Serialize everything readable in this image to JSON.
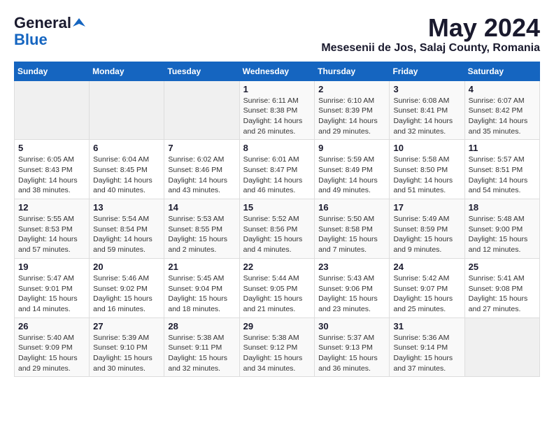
{
  "header": {
    "logo_general": "General",
    "logo_blue": "Blue",
    "month": "May 2024",
    "location": "Mesesenii de Jos, Salaj County, Romania"
  },
  "days_of_week": [
    "Sunday",
    "Monday",
    "Tuesday",
    "Wednesday",
    "Thursday",
    "Friday",
    "Saturday"
  ],
  "weeks": [
    [
      {
        "day": "",
        "info": ""
      },
      {
        "day": "",
        "info": ""
      },
      {
        "day": "",
        "info": ""
      },
      {
        "day": "1",
        "info": "Sunrise: 6:11 AM\nSunset: 8:38 PM\nDaylight: 14 hours and 26 minutes."
      },
      {
        "day": "2",
        "info": "Sunrise: 6:10 AM\nSunset: 8:39 PM\nDaylight: 14 hours and 29 minutes."
      },
      {
        "day": "3",
        "info": "Sunrise: 6:08 AM\nSunset: 8:41 PM\nDaylight: 14 hours and 32 minutes."
      },
      {
        "day": "4",
        "info": "Sunrise: 6:07 AM\nSunset: 8:42 PM\nDaylight: 14 hours and 35 minutes."
      }
    ],
    [
      {
        "day": "5",
        "info": "Sunrise: 6:05 AM\nSunset: 8:43 PM\nDaylight: 14 hours and 38 minutes."
      },
      {
        "day": "6",
        "info": "Sunrise: 6:04 AM\nSunset: 8:45 PM\nDaylight: 14 hours and 40 minutes."
      },
      {
        "day": "7",
        "info": "Sunrise: 6:02 AM\nSunset: 8:46 PM\nDaylight: 14 hours and 43 minutes."
      },
      {
        "day": "8",
        "info": "Sunrise: 6:01 AM\nSunset: 8:47 PM\nDaylight: 14 hours and 46 minutes."
      },
      {
        "day": "9",
        "info": "Sunrise: 5:59 AM\nSunset: 8:49 PM\nDaylight: 14 hours and 49 minutes."
      },
      {
        "day": "10",
        "info": "Sunrise: 5:58 AM\nSunset: 8:50 PM\nDaylight: 14 hours and 51 minutes."
      },
      {
        "day": "11",
        "info": "Sunrise: 5:57 AM\nSunset: 8:51 PM\nDaylight: 14 hours and 54 minutes."
      }
    ],
    [
      {
        "day": "12",
        "info": "Sunrise: 5:55 AM\nSunset: 8:53 PM\nDaylight: 14 hours and 57 minutes."
      },
      {
        "day": "13",
        "info": "Sunrise: 5:54 AM\nSunset: 8:54 PM\nDaylight: 14 hours and 59 minutes."
      },
      {
        "day": "14",
        "info": "Sunrise: 5:53 AM\nSunset: 8:55 PM\nDaylight: 15 hours and 2 minutes."
      },
      {
        "day": "15",
        "info": "Sunrise: 5:52 AM\nSunset: 8:56 PM\nDaylight: 15 hours and 4 minutes."
      },
      {
        "day": "16",
        "info": "Sunrise: 5:50 AM\nSunset: 8:58 PM\nDaylight: 15 hours and 7 minutes."
      },
      {
        "day": "17",
        "info": "Sunrise: 5:49 AM\nSunset: 8:59 PM\nDaylight: 15 hours and 9 minutes."
      },
      {
        "day": "18",
        "info": "Sunrise: 5:48 AM\nSunset: 9:00 PM\nDaylight: 15 hours and 12 minutes."
      }
    ],
    [
      {
        "day": "19",
        "info": "Sunrise: 5:47 AM\nSunset: 9:01 PM\nDaylight: 15 hours and 14 minutes."
      },
      {
        "day": "20",
        "info": "Sunrise: 5:46 AM\nSunset: 9:02 PM\nDaylight: 15 hours and 16 minutes."
      },
      {
        "day": "21",
        "info": "Sunrise: 5:45 AM\nSunset: 9:04 PM\nDaylight: 15 hours and 18 minutes."
      },
      {
        "day": "22",
        "info": "Sunrise: 5:44 AM\nSunset: 9:05 PM\nDaylight: 15 hours and 21 minutes."
      },
      {
        "day": "23",
        "info": "Sunrise: 5:43 AM\nSunset: 9:06 PM\nDaylight: 15 hours and 23 minutes."
      },
      {
        "day": "24",
        "info": "Sunrise: 5:42 AM\nSunset: 9:07 PM\nDaylight: 15 hours and 25 minutes."
      },
      {
        "day": "25",
        "info": "Sunrise: 5:41 AM\nSunset: 9:08 PM\nDaylight: 15 hours and 27 minutes."
      }
    ],
    [
      {
        "day": "26",
        "info": "Sunrise: 5:40 AM\nSunset: 9:09 PM\nDaylight: 15 hours and 29 minutes."
      },
      {
        "day": "27",
        "info": "Sunrise: 5:39 AM\nSunset: 9:10 PM\nDaylight: 15 hours and 30 minutes."
      },
      {
        "day": "28",
        "info": "Sunrise: 5:38 AM\nSunset: 9:11 PM\nDaylight: 15 hours and 32 minutes."
      },
      {
        "day": "29",
        "info": "Sunrise: 5:38 AM\nSunset: 9:12 PM\nDaylight: 15 hours and 34 minutes."
      },
      {
        "day": "30",
        "info": "Sunrise: 5:37 AM\nSunset: 9:13 PM\nDaylight: 15 hours and 36 minutes."
      },
      {
        "day": "31",
        "info": "Sunrise: 5:36 AM\nSunset: 9:14 PM\nDaylight: 15 hours and 37 minutes."
      },
      {
        "day": "",
        "info": ""
      }
    ]
  ]
}
